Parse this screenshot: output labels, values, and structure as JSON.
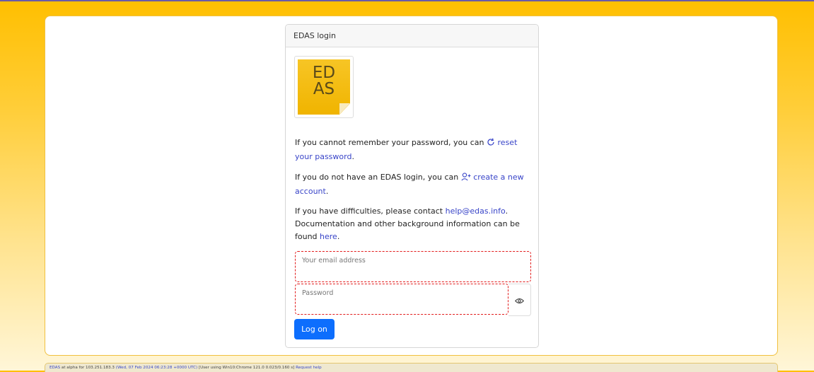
{
  "login": {
    "title": "EDAS login",
    "logo_text_line1": "ED",
    "logo_text_line2": "AS",
    "reset": {
      "before": "If you cannot remember your password, you can ",
      "link": "reset your password",
      "after": "."
    },
    "create": {
      "before": "If you do not have an EDAS login, you can ",
      "link": "create a new account",
      "after": "."
    },
    "contact": {
      "before": "If you have difficulties, please contact ",
      "email": "help@edas.info",
      "middle": ". Documentation and other background information can be found ",
      "here": "here",
      "after": "."
    },
    "email_field": {
      "placeholder": "Your email address",
      "value": ""
    },
    "password_field": {
      "placeholder": "Password",
      "value": ""
    },
    "logon_label": "Log on"
  },
  "footer": {
    "edas": "EDAS",
    "text1": " at alpha for 103.251.183.3 ",
    "timestamp": "(Wed, 07 Feb 2024 06:23:28 +0000 UTC)",
    "text2": " [User using Win10:Chrome 121.0 0.023/0.160 s] ",
    "help": "Request help"
  },
  "icons": {
    "reset": "refresh-icon",
    "create": "add-user-icon",
    "eye": "eye-icon"
  },
  "colors": {
    "primary": "#0d6efd",
    "link": "#3844c8",
    "error": "#e21c1c",
    "logo": "#f7c525"
  }
}
